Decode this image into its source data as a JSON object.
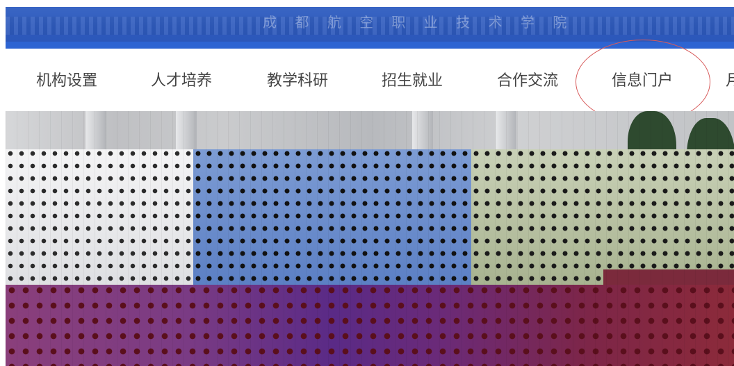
{
  "banner": {
    "title": "成 都 航 空 职 业 技 术 学 院"
  },
  "nav": {
    "items": [
      {
        "label": "机构设置"
      },
      {
        "label": "人才培养"
      },
      {
        "label": "教学科研"
      },
      {
        "label": "招生就业"
      },
      {
        "label": "合作交流"
      },
      {
        "label": "信息门户",
        "highlighted": true
      },
      {
        "label": "月"
      }
    ]
  },
  "colors": {
    "banner": "#2f5bbd",
    "nav_text": "#444444",
    "annotation": "#d75a5a"
  }
}
